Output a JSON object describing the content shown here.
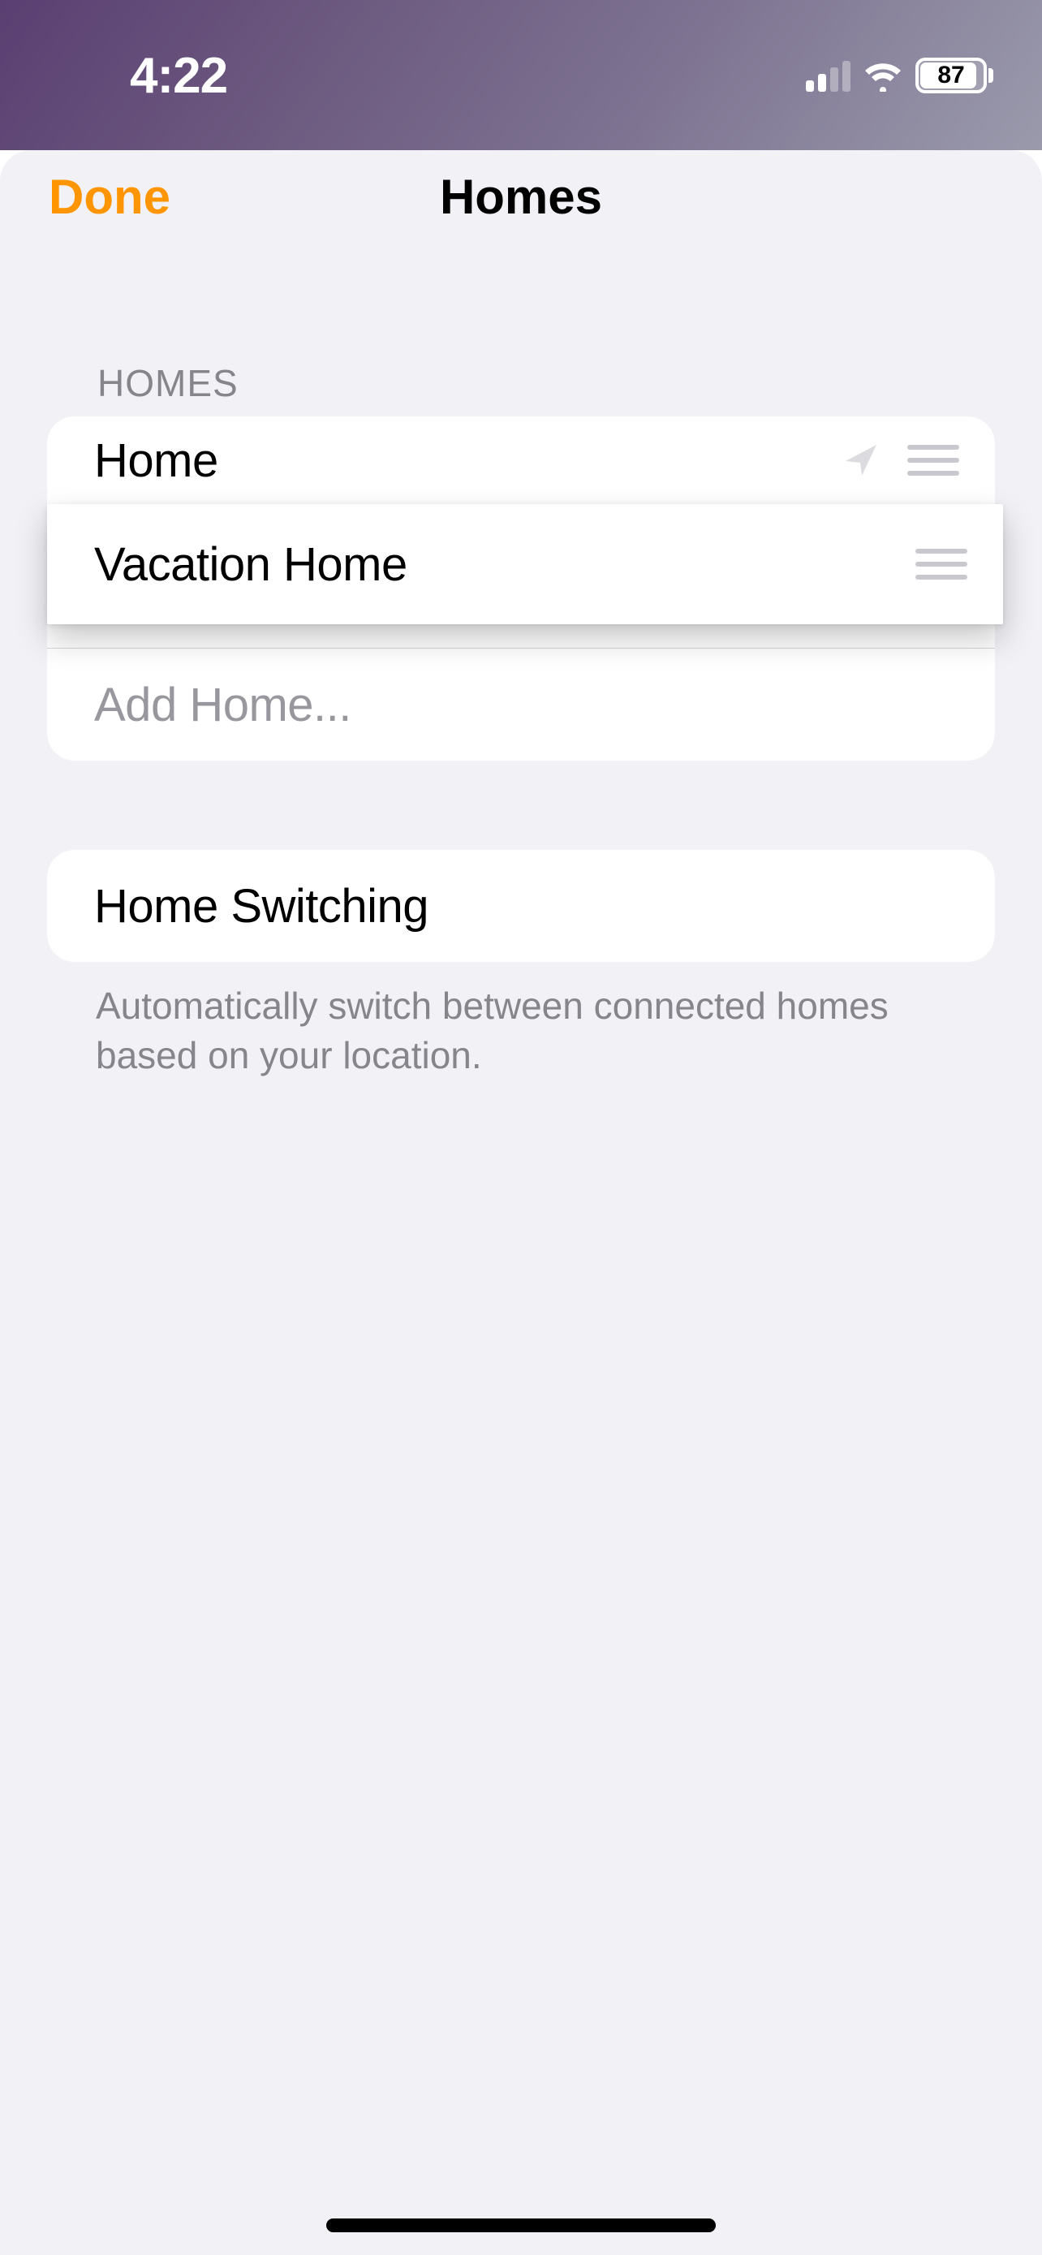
{
  "status": {
    "time": "4:22",
    "battery": "87"
  },
  "nav": {
    "done": "Done",
    "title": "Homes"
  },
  "sections": {
    "homes_header": "HOMES",
    "homes": [
      {
        "label": "Home",
        "location_indicator": true
      },
      {
        "label": "Vacation Home",
        "location_indicator": false
      }
    ],
    "add_home": "Add Home...",
    "switching": {
      "label": "Home Switching",
      "footer": "Automatically switch between connected homes based on your location."
    }
  }
}
